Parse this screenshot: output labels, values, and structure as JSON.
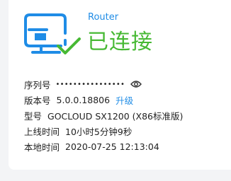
{
  "status": {
    "device_type": "Router",
    "title": "已连接",
    "status_color": "#47b934",
    "accent_color": "#1f8ce6",
    "icon": "router-connected-icon"
  },
  "info": {
    "serial": {
      "label": "序列号",
      "masked_value": "••••••••••••••••",
      "toggle_icon": "eye-icon"
    },
    "version": {
      "label": "版本号",
      "value": "5.0.0.18806",
      "upgrade_label": "升级"
    },
    "model": {
      "label": "型号",
      "value": "GOCLOUD SX1200 (X86标准版)"
    },
    "uptime": {
      "label": "上线时间",
      "value": "10小时5分钟9秒"
    },
    "local_time": {
      "label": "本地时间",
      "value": "2020-07-25 12:13:04"
    }
  }
}
